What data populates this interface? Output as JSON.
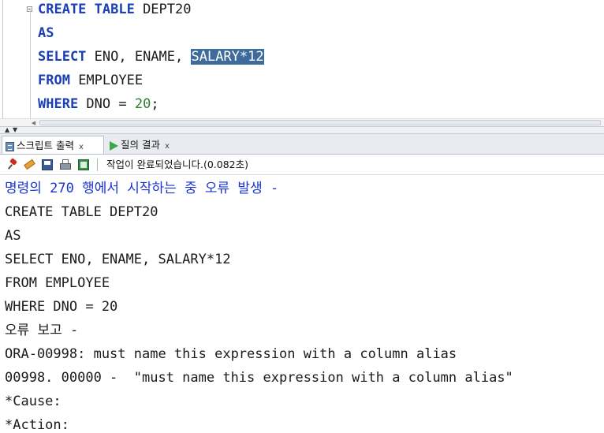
{
  "editor": {
    "lines": [
      {
        "kw": "CREATE TABLE",
        "rest": " DEPT20"
      },
      {
        "kw": "AS",
        "rest": ""
      },
      {
        "kw": "SELECT",
        "rest": " ENO, ENAME, ",
        "selected": "SALARY*12"
      },
      {
        "kw": "FROM",
        "rest": " EMPLOYEE"
      },
      {
        "kw": "WHERE",
        "rest": " DNO = ",
        "num": "20",
        "tail": ";"
      }
    ]
  },
  "tabs": [
    {
      "label": "스크립트 출력",
      "close": "x",
      "active": true
    },
    {
      "label": "질의 결과",
      "close": "x",
      "active": false
    }
  ],
  "toolbar": {
    "status": "작업이 완료되었습니다.(0.082초)"
  },
  "output": {
    "lines": [
      "명령의 270 행에서 시작하는 중 오류 발생 -",
      "CREATE TABLE DEPT20",
      "AS",
      "SELECT ENO, ENAME, SALARY*12",
      "FROM EMPLOYEE",
      "WHERE DNO = 20",
      "오류 보고 -",
      "ORA-00998: must name this expression with a column alias",
      "00998. 00000 -  \"must name this expression with a column alias\"",
      "*Cause:",
      "*Action:"
    ]
  },
  "colors": {
    "keyword": "#1b3fb4",
    "number": "#2b7d2b",
    "selection": "#3e6b9c",
    "error_header": "#1a34d4"
  }
}
